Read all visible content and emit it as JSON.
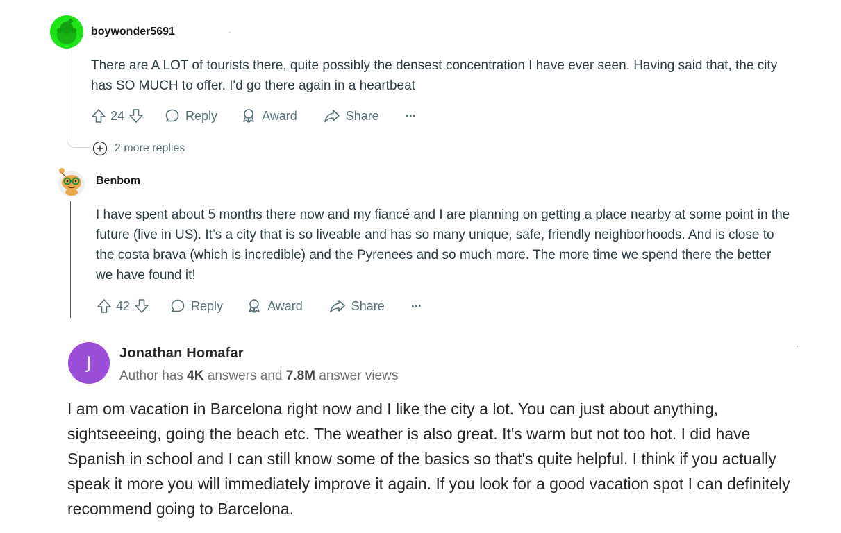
{
  "comments": [
    {
      "username": "boywonder5691",
      "text": "There are A LOT of tourists there, quite possibly the densest concentration I have ever seen. Having said that, the city has SO MUCH to offer. I'd go there again in a heartbeat",
      "votes": "24",
      "reply_label": "Reply",
      "award_label": "Award",
      "share_label": "Share",
      "more_label": "···",
      "more_replies": "2 more replies",
      "avatar_color": "#1ee319"
    },
    {
      "username": "Benbom",
      "text": "I have spent about 5 months there now and my fiancé and I are planning on getting a place nearby at some point in the future (live in US). It’s a city that is so liveable and has so many unique, safe, friendly neighborhoods. And is close to the costa brava (which is incredible) and the Pyrenees and so much more. The more time we spend there the better we have found it!",
      "votes": "42",
      "reply_label": "Reply",
      "award_label": "Award",
      "share_label": "Share",
      "more_label": "···"
    }
  ],
  "answer": {
    "avatar_letter": "J",
    "avatar_color": "#9b4fd8",
    "author_name": "Jonathan Homafar",
    "meta_prefix": "Author has ",
    "answers_count": "4K",
    "meta_mid": " answers and ",
    "views_count": "7.8M",
    "meta_suffix": " answer views",
    "text": "I am om vacation in Barcelona right now and I like the city a lot. You can just about anything, sightseeeing, going the beach etc. The weather is also great. It's warm but not too hot. I did have Spanish in school and I can still know some of the basics so that's quite helpful. I think if you actually speak it more you will immediately improve it again. If you look for a good vacation spot I can definitely recommend going to Barcelona."
  }
}
